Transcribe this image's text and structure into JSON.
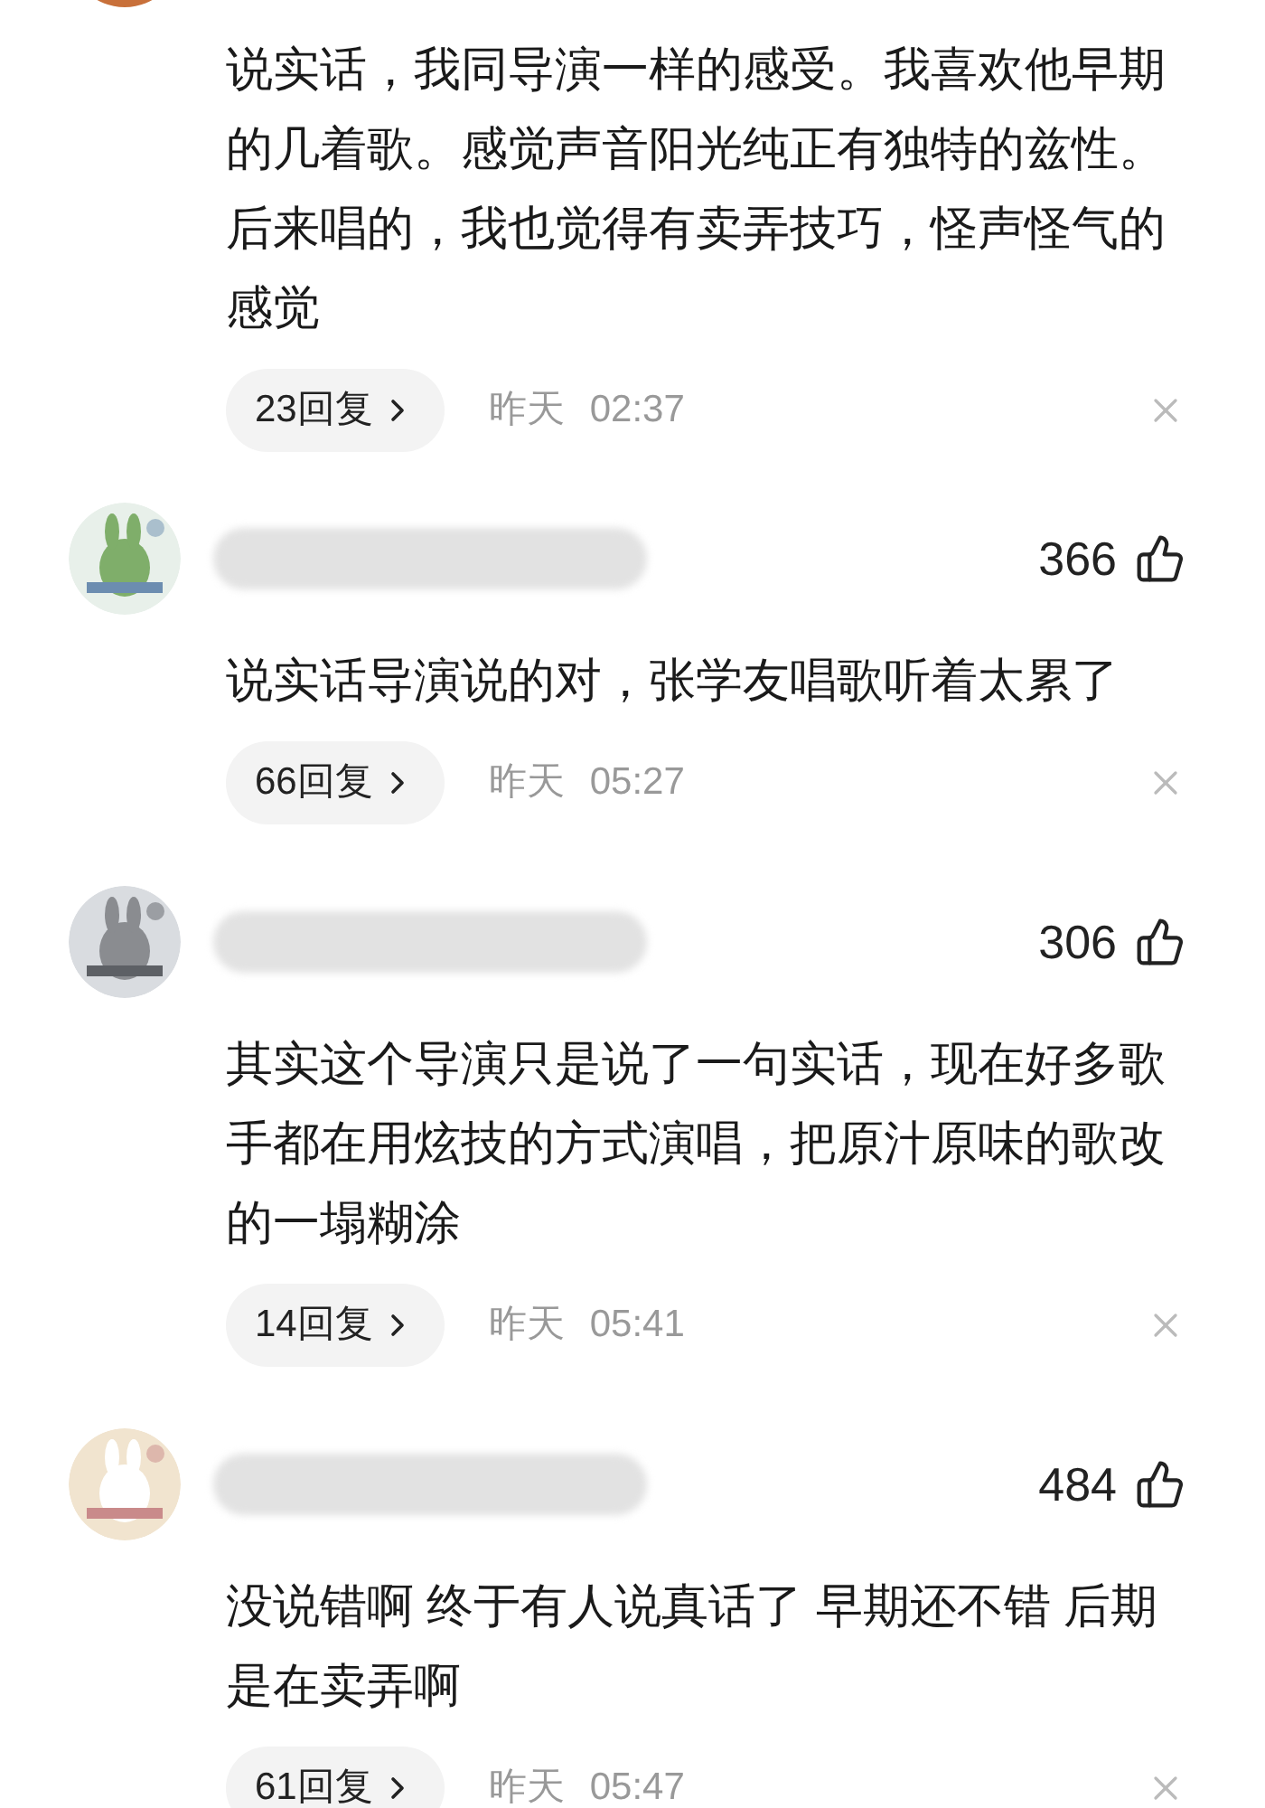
{
  "comments": [
    {
      "text": "说实话，我同导演一样的感受。我喜欢他早期的几着歌。感觉声音阳光纯正有独特的兹性。后来唱的，我也觉得有卖弄技巧，怪声怪气的感觉",
      "replies": "23回复",
      "date": "昨天",
      "time": "02:37"
    },
    {
      "likes": "366",
      "text": "说实话导演说的对，张学友唱歌听着太累了",
      "replies": "66回复",
      "date": "昨天",
      "time": "05:27"
    },
    {
      "likes": "306",
      "text": "其实这个导演只是说了一句实话，现在好多歌手都在用炫技的方式演唱，把原汁原味的歌改的一塌糊涂",
      "replies": "14回复",
      "date": "昨天",
      "time": "05:41"
    },
    {
      "likes": "484",
      "text": "没说错啊 终于有人说真话了 早期还不错 后期是在卖弄啊",
      "replies": "61回复",
      "date": "昨天",
      "time": "05:47"
    }
  ]
}
